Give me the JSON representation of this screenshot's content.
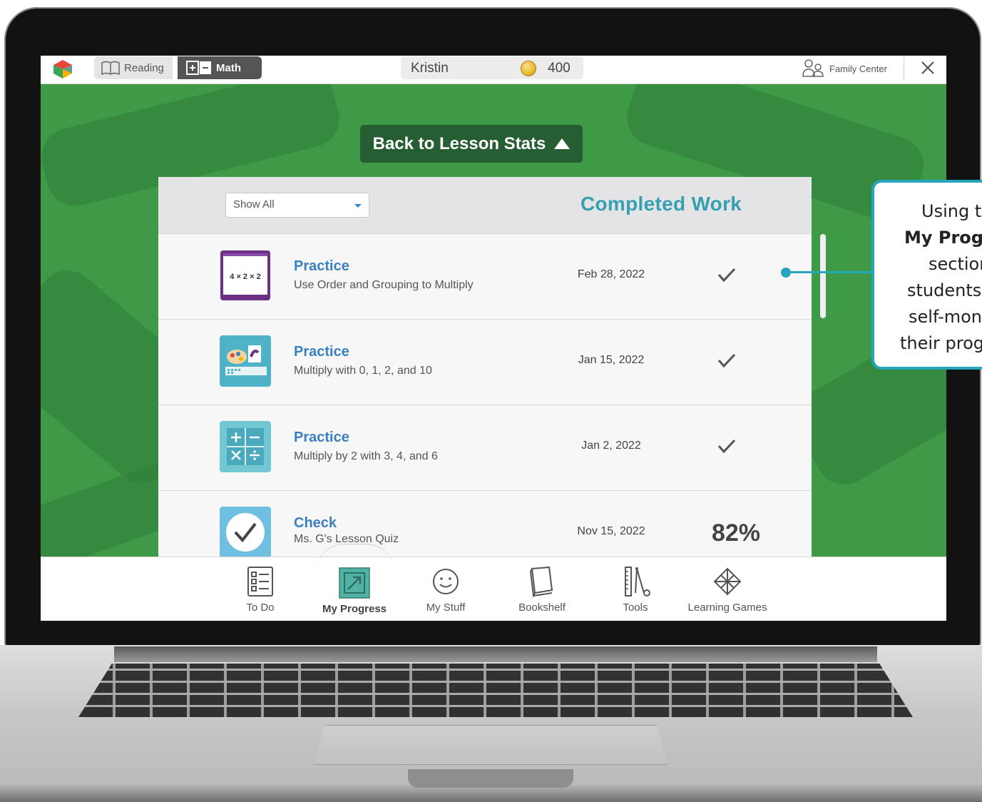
{
  "topbar": {
    "reading_label": "Reading",
    "math_label": "Math",
    "user_name": "Kristin",
    "coins": "400",
    "family_center_label": "Family Center"
  },
  "back_button_label": "Back to Lesson Stats",
  "panel": {
    "filter_value": "Show All",
    "title": "Completed Work",
    "rows": [
      {
        "type": "Practice",
        "description": "Use Order and Grouping to Multiply",
        "date": "Feb 28, 2022",
        "status": "check",
        "thumb_text": "4 × 2 × 2"
      },
      {
        "type": "Practice",
        "description": "Multiply with 0, 1, 2, and 10",
        "date": "Jan 15, 2022",
        "status": "check"
      },
      {
        "type": "Practice",
        "description": "Multiply by 2 with 3, 4, and 6",
        "date": "Jan 2, 2022",
        "status": "check"
      },
      {
        "type": "Check",
        "description": "Ms. G's Lesson Quiz",
        "date": "Nov 15, 2022",
        "status": "score",
        "score": "82%"
      }
    ]
  },
  "bottom_nav": [
    {
      "label": "To Do",
      "icon": "checklist-icon"
    },
    {
      "label": "My Progress",
      "icon": "progress-arrow-icon",
      "active": true
    },
    {
      "label": "My Stuff",
      "icon": "smiley-icon"
    },
    {
      "label": "Bookshelf",
      "icon": "book-icon"
    },
    {
      "label": "Tools",
      "icon": "ruler-tools-icon"
    },
    {
      "label": "Learning Games",
      "icon": "games-icon"
    }
  ],
  "callout": {
    "line1": "Using th",
    "line2": "My Progr",
    "line3": "section",
    "line4": "students",
    "line5": "self-mon",
    "line6": "their prog"
  },
  "colors": {
    "background_green": "#3e9a47",
    "back_button": "#275d32",
    "title_teal": "#35a0b2",
    "link_blue": "#3a7fc0",
    "callout_teal": "#26a6bd"
  }
}
